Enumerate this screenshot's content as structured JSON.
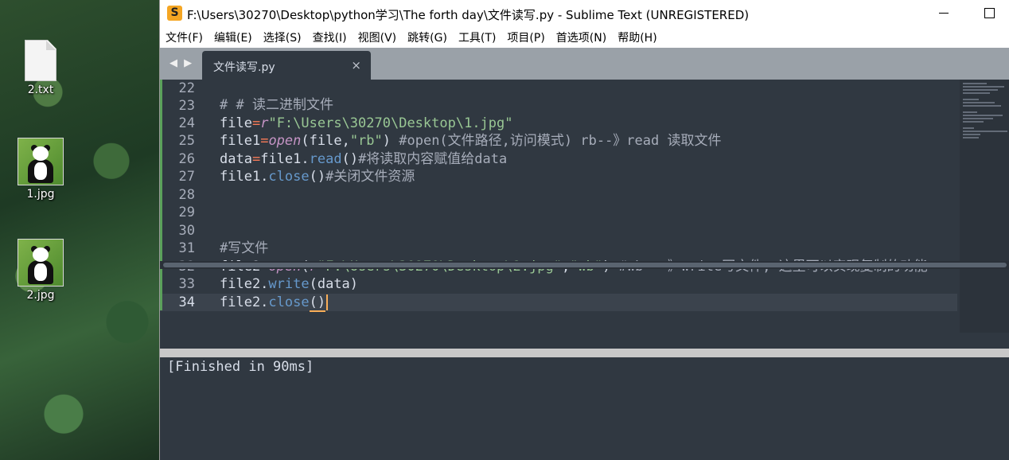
{
  "desktop": {
    "icons": [
      {
        "label": "2.txt",
        "type": "text-file"
      },
      {
        "label": "1.jpg",
        "type": "image-file"
      },
      {
        "label": "2.jpg",
        "type": "image-file"
      }
    ]
  },
  "window": {
    "title": "F:\\Users\\30270\\Desktop\\python学习\\The forth day\\文件读写.py - Sublime Text (UNREGISTERED)",
    "app_icon_glyph": "S"
  },
  "menu": [
    "文件(F)",
    "编辑(E)",
    "选择(S)",
    "查找(I)",
    "视图(V)",
    "跳转(G)",
    "工具(T)",
    "项目(P)",
    "首选项(N)",
    "帮助(H)"
  ],
  "tabs": {
    "nav_glyph": "◀ ▶",
    "active": {
      "label": "文件读写.py",
      "close_glyph": "×"
    }
  },
  "editor": {
    "line_numbers": [
      "22",
      "23",
      "24",
      "25",
      "26",
      "27",
      "28",
      "29",
      "30",
      "31",
      "32",
      "33",
      "34"
    ],
    "current_line": "34",
    "colors": {
      "background": "#303841",
      "comment": "#a7adba",
      "operator": "#f97b58",
      "string": "#99c794",
      "method": "#6699cc",
      "builtin": "#c594c5",
      "cursor": "#f9ae58"
    },
    "tokens": {
      "l23_comment": "# # 读二进制文件",
      "l24_var": "file",
      "l24_eq": "=",
      "l24_prefix": "r",
      "l24_str": "\"F:\\Users\\30270\\Desktop\\1.jpg\"",
      "l25_var": "file1",
      "l25_eq": "=",
      "l25_fn": "open",
      "l25_args_a": "(file,",
      "l25_str": "\"rb\"",
      "l25_args_b": ") ",
      "l25_comment": "#open(文件路径,访问模式) rb--》read 读取文件",
      "l26_var": "data",
      "l26_eq": "=",
      "l26_obj": "file1.",
      "l26_method": "read",
      "l26_parens": "()",
      "l26_comment": "#将读取内容赋值给data",
      "l27_obj": "file1.",
      "l27_method": "close",
      "l27_parens": "()",
      "l27_comment": "#关闭文件资源",
      "l31_comment": "#写文件",
      "l32_var": "file2",
      "l32_eq": "=",
      "l32_fn": "open",
      "l32_paren": "(",
      "l32_prefix": "r",
      "l32_str1": "\"F:\\Users\\30270\\Desktop\\2.jpg\"",
      "l32_comma": ",",
      "l32_str2": "\"wb\"",
      "l32_close": ") ",
      "l32_comment": "#wb---》write写文件, 这里可以实现复制的功能",
      "l33_obj": "file2.",
      "l33_method": "write",
      "l33_args": "(data)",
      "l34_obj": "file2.",
      "l34_method": "close",
      "l34_open": "(",
      "l34_close": ")"
    }
  },
  "output": {
    "text": "[Finished in 90ms]"
  }
}
